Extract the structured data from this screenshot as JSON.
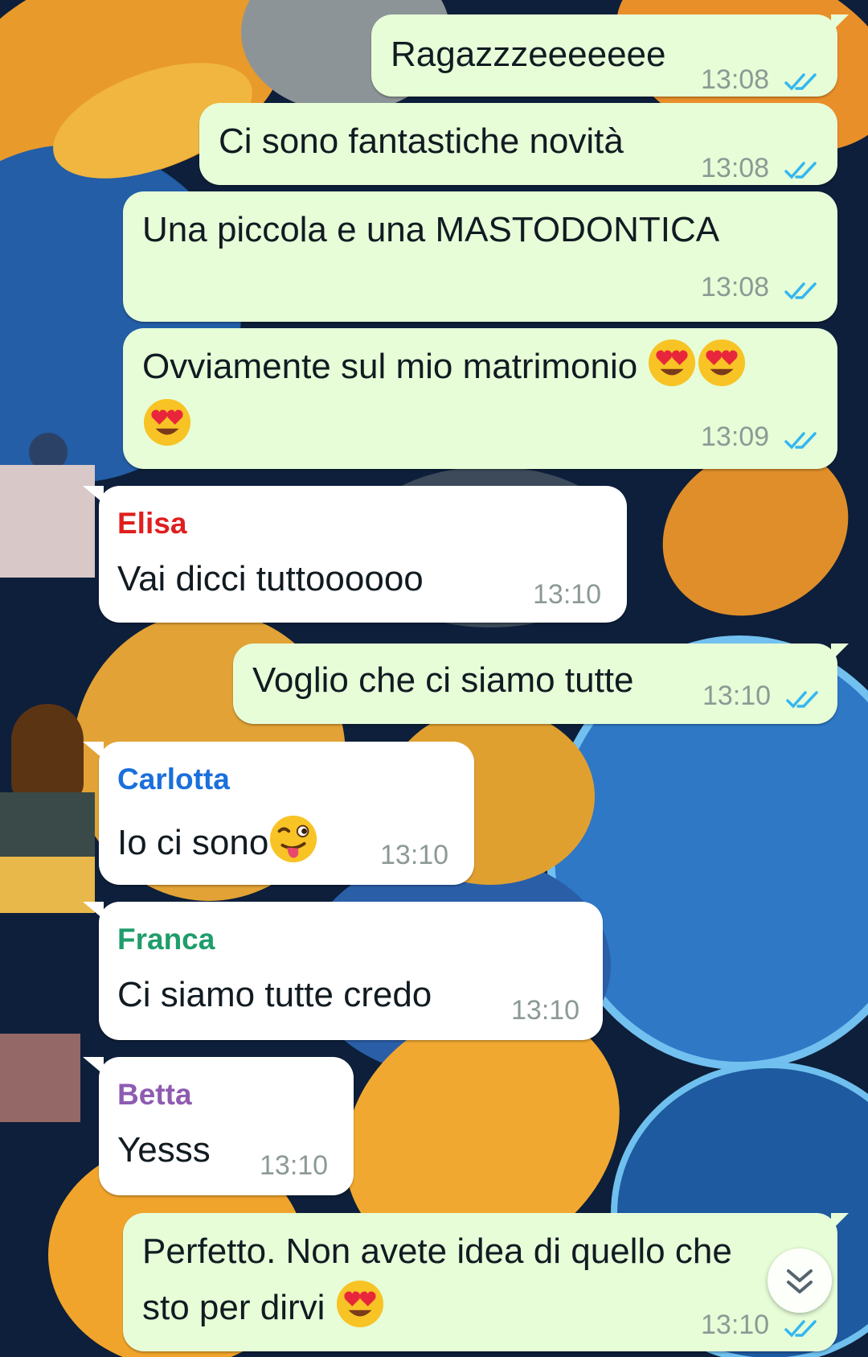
{
  "colors": {
    "outgoing_bubble": "#e7fdd8",
    "incoming_bubble": "#ffffff",
    "read_ticks": "#34b7f1",
    "sender_elisa": "#e01e1e",
    "sender_carlotta": "#1a6fdc",
    "sender_franca": "#1f9d6b",
    "sender_betta": "#8e5bb1"
  },
  "messages": [
    {
      "direction": "out",
      "text": "Ragazzzeeeeeee",
      "time": "13:08",
      "status": "read-double-check-icon"
    },
    {
      "direction": "out",
      "text": "Ci sono fantastiche novità",
      "time": "13:08",
      "status": "read-double-check-icon"
    },
    {
      "direction": "out",
      "text": "Una piccola e una MASTODONTICA",
      "time": "13:08",
      "status": "read-double-check-icon"
    },
    {
      "direction": "out",
      "text": "Ovviamente sul mio matrimonio",
      "emojis": [
        "heart-eyes-emoji",
        "heart-eyes-emoji",
        "heart-eyes-emoji"
      ],
      "time": "13:09",
      "status": "read-double-check-icon"
    },
    {
      "direction": "in",
      "sender": "Elisa",
      "text": "Vai dicci tuttoooooo",
      "time": "13:10"
    },
    {
      "direction": "out",
      "text": "Voglio che ci siamo tutte",
      "time": "13:10",
      "status": "read-double-check-icon"
    },
    {
      "direction": "in",
      "sender": "Carlotta",
      "text": "Io ci sono",
      "emojis": [
        "winking-tongue-emoji"
      ],
      "time": "13:10"
    },
    {
      "direction": "in",
      "sender": "Franca",
      "text": "Ci siamo tutte credo",
      "time": "13:10"
    },
    {
      "direction": "in",
      "sender": "Betta",
      "text": "Yesss",
      "time": "13:10"
    },
    {
      "direction": "out",
      "text": "Perfetto. Non avete idea di quello che",
      "text2": "sto per dirvi",
      "emojis": [
        "heart-eyes-emoji"
      ],
      "time": "13:10",
      "status": "read-double-check-icon"
    }
  ],
  "scroll_button": {
    "icon": "double-chevron-down-icon"
  }
}
